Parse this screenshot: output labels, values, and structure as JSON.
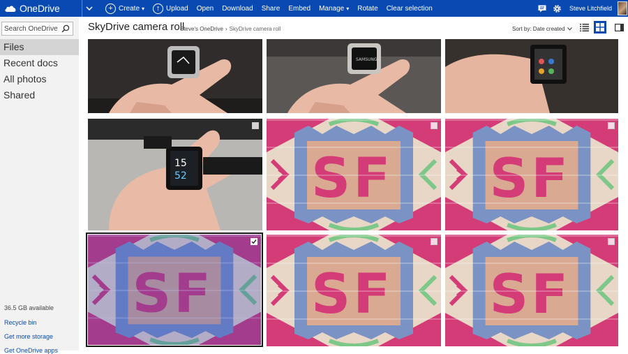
{
  "topbar": {
    "brand": "OneDrive",
    "commands": [
      {
        "label": "Create",
        "icon": "plus-icon",
        "has_menu": true
      },
      {
        "label": "Upload",
        "icon": "upload-icon",
        "has_menu": false
      },
      {
        "label": "Open",
        "has_menu": false
      },
      {
        "label": "Download",
        "has_menu": false
      },
      {
        "label": "Share",
        "has_menu": false
      },
      {
        "label": "Embed",
        "has_menu": false
      },
      {
        "label": "Manage",
        "has_menu": true
      },
      {
        "label": "Rotate",
        "has_menu": false
      },
      {
        "label": "Clear selection",
        "has_menu": false
      }
    ],
    "user_name": "Steve Litchfield",
    "accent": "#094ab2"
  },
  "sidebar": {
    "search_placeholder": "Search OneDrive",
    "items": [
      {
        "label": "Files",
        "selected": true
      },
      {
        "label": "Recent docs",
        "selected": false
      },
      {
        "label": "All photos",
        "selected": false
      },
      {
        "label": "Shared",
        "selected": false
      }
    ],
    "storage": "36.5 GB available",
    "links": [
      "Recycle bin",
      "Get more storage",
      "Get OneDrive apps"
    ]
  },
  "main": {
    "title": "SkyDrive camera roll",
    "breadcrumb": [
      "Steve's OneDrive",
      "SkyDrive camera roll"
    ],
    "sort_label": "Sort by: Date created",
    "views": [
      {
        "icon": "list-view-icon",
        "active": false
      },
      {
        "icon": "thumbnail-view-icon",
        "active": true
      },
      {
        "icon": "details-pane-icon",
        "active": false
      }
    ]
  },
  "photos": [
    {
      "subject": "watch-on-wrist-hand",
      "selected": false
    },
    {
      "subject": "watch-samsung-screen",
      "selected": false
    },
    {
      "subject": "watch-sony-menu",
      "selected": false
    },
    {
      "subject": "watch-sony-clock",
      "selected": false
    },
    {
      "subject": "sf-cross-stitch",
      "selected": false
    },
    {
      "subject": "sf-cross-stitch",
      "selected": false
    },
    {
      "subject": "sf-cross-stitch",
      "selected": true
    },
    {
      "subject": "sf-cross-stitch",
      "selected": false
    },
    {
      "subject": "sf-cross-stitch",
      "selected": false
    }
  ]
}
